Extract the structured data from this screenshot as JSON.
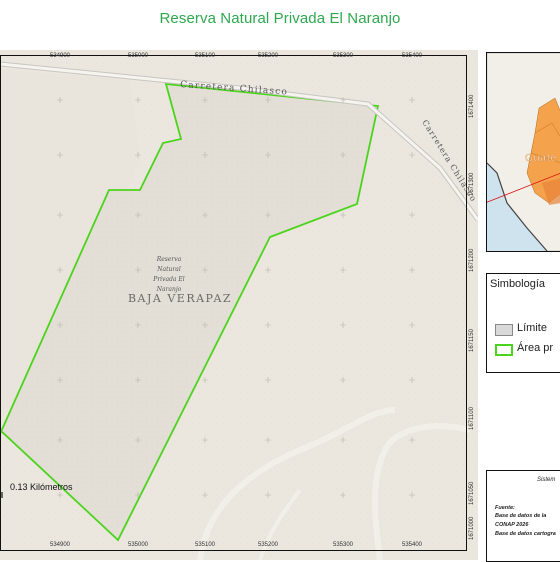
{
  "title": "Reserva Natural Privada El Naranjo",
  "colors": {
    "title": "#2fa84f",
    "reserve_outline": "#4cd41c",
    "basemap": "#ebe7df",
    "reserve_fill": "#e4e0d6",
    "road_casing": "#c9c6c0"
  },
  "map": {
    "x_ticks_top": [
      "534900",
      "535000",
      "535100",
      "535200",
      "535300",
      "535400"
    ],
    "x_ticks_bottom": [
      "534900",
      "535000",
      "535100",
      "535200",
      "535300",
      "535400"
    ],
    "y_ticks_right": [
      "1671400",
      "1671300",
      "1671200",
      "1671150",
      "1671100",
      "1671050",
      "1671000"
    ],
    "road_label_top": "Carretera Chilasco",
    "road_label_side": "Carretera Chilasco",
    "reserve_label": [
      "Reserva",
      "Natural",
      "Privada El",
      "Naranjo"
    ],
    "department_label": "BAJA VERAPAZ",
    "scale_label": "0.13 Kilómetros"
  },
  "inset": {
    "country_label": "Guate"
  },
  "legend": {
    "title": "Simbología",
    "items": [
      {
        "label": "Límite",
        "swatch": "#d9d9d9",
        "border": "#888888"
      },
      {
        "label": "Área pr",
        "swatch": "#ffffff",
        "border": "#4cd41c"
      }
    ]
  },
  "info": {
    "system": "Sistem",
    "lines": [
      "Fuente:",
      "Base de datos de la",
      "CONAP 2026",
      "Base de datos cartogra"
    ]
  }
}
